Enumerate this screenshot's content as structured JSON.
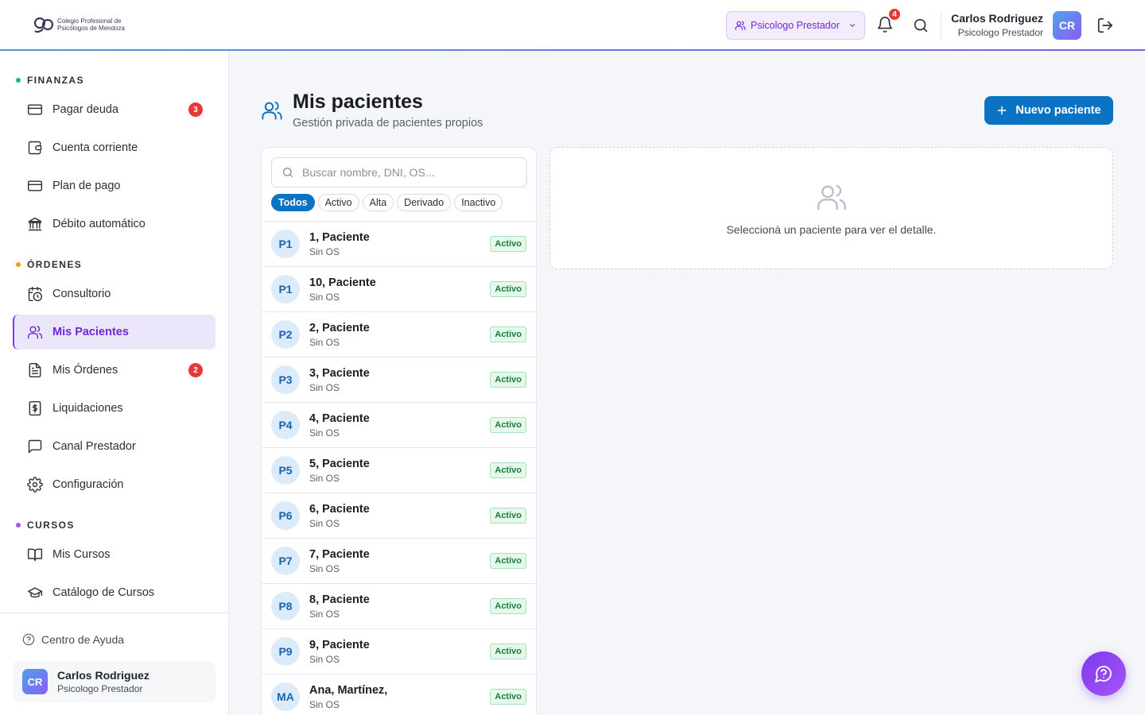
{
  "header": {
    "logo_line1": "Colegio Profesional de",
    "logo_line2": "Psicólogos de Mendoza",
    "role_select_value": "Psicologo Prestador",
    "notifications_count": "4",
    "user_name": "Carlos Rodriguez",
    "user_role": "Psicologo Prestador",
    "user_initials": "CR"
  },
  "sidebar": {
    "sections": [
      {
        "title": "FINANZAS",
        "dot_color": "#10b981"
      },
      {
        "title": "ÓRDENES",
        "dot_color": "#f59e0b"
      },
      {
        "title": "CURSOS",
        "dot_color": "#a855f7"
      }
    ],
    "items": [
      {
        "label": "Pagar deuda",
        "icon": "credit-card-icon",
        "badge": "3"
      },
      {
        "label": "Cuenta corriente",
        "icon": "wallet-icon"
      },
      {
        "label": "Plan de pago",
        "icon": "credit-card-icon"
      },
      {
        "label": "Débito automático",
        "icon": "bank-icon"
      },
      {
        "label": "Consultorio",
        "icon": "calendar-clock-icon"
      },
      {
        "label": "Mis Pacientes",
        "icon": "users-icon",
        "active": true
      },
      {
        "label": "Mis Órdenes",
        "icon": "file-text-icon",
        "badge": "2"
      },
      {
        "label": "Liquidaciones",
        "icon": "receipt-dollar-icon"
      },
      {
        "label": "Canal Prestador",
        "icon": "message-square-icon"
      },
      {
        "label": "Configuración",
        "icon": "gear-icon"
      },
      {
        "label": "Mis Cursos",
        "icon": "book-open-icon"
      },
      {
        "label": "Catálogo de Cursos",
        "icon": "graduation-cap-icon"
      }
    ],
    "help_label": "Centro de Ayuda",
    "user_name": "Carlos Rodriguez",
    "user_role": "Psicologo Prestador",
    "user_initials": "CR"
  },
  "main": {
    "title": "Mis pacientes",
    "subtitle": "Gestión privada de pacientes propios",
    "new_button_label": "Nuevo paciente",
    "search_placeholder": "Buscar nombre, DNI, OS...",
    "filters": [
      "Todos",
      "Activo",
      "Alta",
      "Derivado",
      "Inactivo"
    ],
    "active_filter": "Todos",
    "patients": [
      {
        "initials": "P1",
        "name": "1, Paciente",
        "os": "Sin OS",
        "status": "Activo"
      },
      {
        "initials": "P1",
        "name": "10, Paciente",
        "os": "Sin OS",
        "status": "Activo"
      },
      {
        "initials": "P2",
        "name": "2, Paciente",
        "os": "Sin OS",
        "status": "Activo"
      },
      {
        "initials": "P3",
        "name": "3, Paciente",
        "os": "Sin OS",
        "status": "Activo"
      },
      {
        "initials": "P4",
        "name": "4, Paciente",
        "os": "Sin OS",
        "status": "Activo"
      },
      {
        "initials": "P5",
        "name": "5, Paciente",
        "os": "Sin OS",
        "status": "Activo"
      },
      {
        "initials": "P6",
        "name": "6, Paciente",
        "os": "Sin OS",
        "status": "Activo"
      },
      {
        "initials": "P7",
        "name": "7, Paciente",
        "os": "Sin OS",
        "status": "Activo"
      },
      {
        "initials": "P8",
        "name": "8, Paciente",
        "os": "Sin OS",
        "status": "Activo"
      },
      {
        "initials": "P9",
        "name": "9, Paciente",
        "os": "Sin OS",
        "status": "Activo"
      },
      {
        "initials": "MA",
        "name": "Ana, Martínez,",
        "os": "Sin OS",
        "status": "Activo"
      }
    ],
    "detail_empty_text": "Seleccioná un paciente para ver el detalle."
  },
  "colors": {
    "primary": "#0b73c4",
    "accent": "#7c3aed",
    "danger": "#e53935",
    "success": "#16803a"
  }
}
